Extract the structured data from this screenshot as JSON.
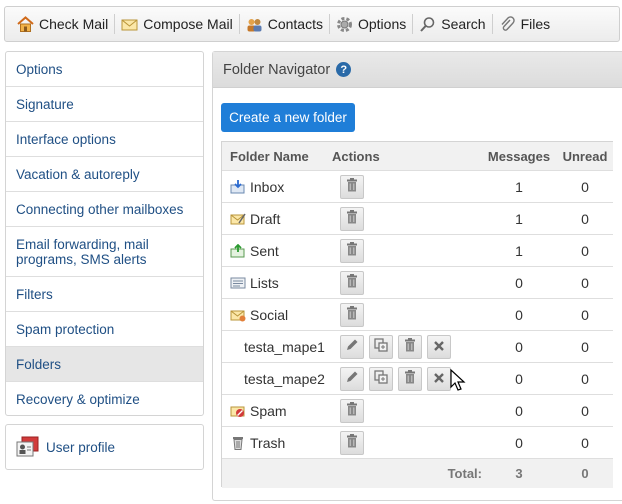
{
  "toolbar": {
    "items": [
      {
        "label": "Check Mail",
        "icon": "home-icon"
      },
      {
        "label": "Compose Mail",
        "icon": "envelope-icon"
      },
      {
        "label": "Contacts",
        "icon": "contacts-icon"
      },
      {
        "label": "Options",
        "icon": "gear-icon"
      },
      {
        "label": "Search",
        "icon": "search-icon"
      },
      {
        "label": "Files",
        "icon": "paperclip-icon"
      }
    ]
  },
  "sidebar": {
    "items": [
      {
        "label": "Options"
      },
      {
        "label": "Signature"
      },
      {
        "label": "Interface options"
      },
      {
        "label": "Vacation & autoreply"
      },
      {
        "label": "Connecting other mailboxes"
      },
      {
        "label": "Email forwarding, mail programs, SMS alerts"
      },
      {
        "label": "Filters"
      },
      {
        "label": "Spam protection"
      },
      {
        "label": "Folders"
      },
      {
        "label": "Recovery & optimize"
      }
    ],
    "active": "Folders",
    "profile_label": "User profile"
  },
  "main": {
    "title": "Folder Navigator",
    "help_glyph": "?",
    "create_button": "Create a new folder",
    "columns": {
      "name": "Folder Name",
      "actions": "Actions",
      "messages": "Messages",
      "unread": "Unread"
    },
    "folders": [
      {
        "name": "Inbox",
        "messages": "1",
        "unread": "0"
      },
      {
        "name": "Draft",
        "messages": "1",
        "unread": "0"
      },
      {
        "name": "Sent",
        "messages": "1",
        "unread": "0"
      },
      {
        "name": "Lists",
        "messages": "0",
        "unread": "0"
      },
      {
        "name": "Social",
        "messages": "0",
        "unread": "0"
      },
      {
        "name": "testa_mape1",
        "messages": "0",
        "unread": "0"
      },
      {
        "name": "testa_mape2",
        "messages": "0",
        "unread": "0"
      },
      {
        "name": "Spam",
        "messages": "0",
        "unread": "0"
      },
      {
        "name": "Trash",
        "messages": "0",
        "unread": "0"
      }
    ],
    "total": {
      "label": "Total:",
      "messages": "3",
      "unread": "0"
    }
  },
  "colors": {
    "accent": "#1f7ed8",
    "link": "#1f4f84",
    "help": "#2a6aa8"
  }
}
